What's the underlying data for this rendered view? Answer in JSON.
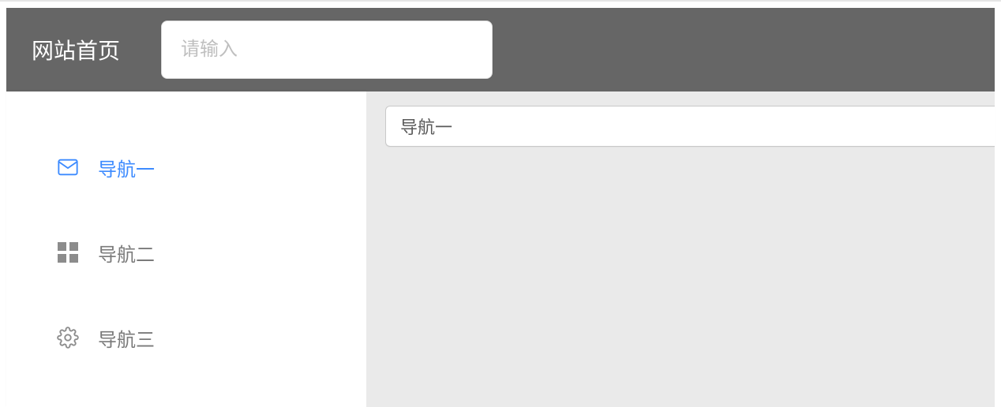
{
  "header": {
    "title": "网站首页",
    "search_placeholder": "请输入"
  },
  "sidebar": {
    "items": [
      {
        "label": "导航一"
      },
      {
        "label": "导航二"
      },
      {
        "label": "导航三"
      }
    ]
  },
  "main": {
    "content_title": "导航一"
  }
}
